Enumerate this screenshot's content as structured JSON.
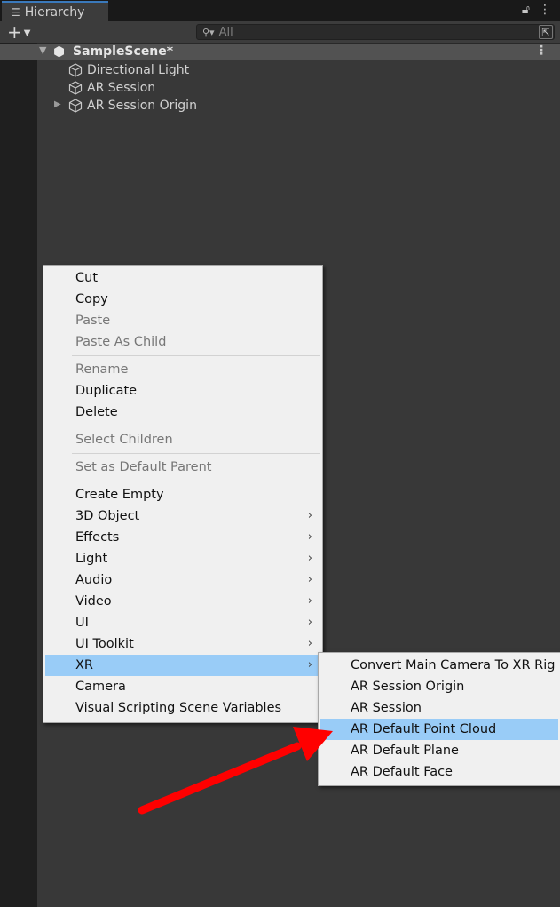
{
  "panel": {
    "tab_title": "Hierarchy",
    "search_placeholder": "All",
    "scene_name": "SampleScene*"
  },
  "hierarchy": {
    "items": [
      {
        "label": "Directional Light",
        "has_children": false
      },
      {
        "label": "AR Session",
        "has_children": false
      },
      {
        "label": "AR Session Origin",
        "has_children": true
      }
    ]
  },
  "context_menu": {
    "items": [
      {
        "label": "Cut",
        "disabled": false,
        "submenu": false
      },
      {
        "label": "Copy",
        "disabled": false,
        "submenu": false
      },
      {
        "label": "Paste",
        "disabled": true,
        "submenu": false
      },
      {
        "label": "Paste As Child",
        "disabled": true,
        "submenu": false
      },
      {
        "label": "Rename",
        "disabled": true,
        "submenu": false
      },
      {
        "label": "Duplicate",
        "disabled": false,
        "submenu": false
      },
      {
        "label": "Delete",
        "disabled": false,
        "submenu": false
      },
      {
        "label": "Select Children",
        "disabled": true,
        "submenu": false
      },
      {
        "label": "Set as Default Parent",
        "disabled": true,
        "submenu": false
      },
      {
        "label": "Create Empty",
        "disabled": false,
        "submenu": false
      },
      {
        "label": "3D Object",
        "disabled": false,
        "submenu": true
      },
      {
        "label": "Effects",
        "disabled": false,
        "submenu": true
      },
      {
        "label": "Light",
        "disabled": false,
        "submenu": true
      },
      {
        "label": "Audio",
        "disabled": false,
        "submenu": true
      },
      {
        "label": "Video",
        "disabled": false,
        "submenu": true
      },
      {
        "label": "UI",
        "disabled": false,
        "submenu": true
      },
      {
        "label": "UI Toolkit",
        "disabled": false,
        "submenu": true
      },
      {
        "label": "XR",
        "disabled": false,
        "submenu": true,
        "highlighted": true
      },
      {
        "label": "Camera",
        "disabled": false,
        "submenu": false
      },
      {
        "label": "Visual Scripting Scene Variables",
        "disabled": false,
        "submenu": false
      }
    ]
  },
  "xr_submenu": {
    "items": [
      {
        "label": "Convert Main Camera To XR Rig"
      },
      {
        "label": "AR Session Origin"
      },
      {
        "label": "AR Session"
      },
      {
        "label": "AR Default Point Cloud",
        "highlighted": true
      },
      {
        "label": "AR Default Plane"
      },
      {
        "label": "AR Default Face"
      }
    ]
  },
  "colors": {
    "highlight": "#99ccf7",
    "annotation_arrow": "#ff0000",
    "tab_accent": "#3a79bb"
  }
}
